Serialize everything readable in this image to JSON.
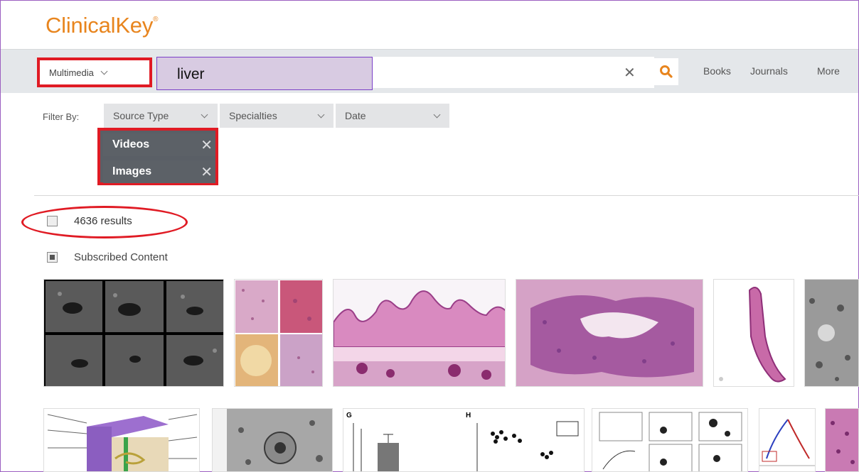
{
  "brand": {
    "name": "ClinicalKey",
    "mark": "®"
  },
  "search": {
    "scope_label": "Multimedia",
    "query": "liver"
  },
  "nav": [
    "Books",
    "Journals",
    "More"
  ],
  "filters": {
    "label": "Filter By:",
    "dropdowns": [
      "Source Type",
      "Specialties",
      "Date"
    ],
    "active_chips": [
      "Videos",
      "Images"
    ]
  },
  "results": {
    "count_text": "4636 results",
    "subscribed_label": "Subscribed Content"
  },
  "thumbnails_row1": [
    "ultrasound-grid",
    "histology-quad",
    "histology-wide",
    "histology-glands",
    "histology-villus",
    "electron-micrograph"
  ],
  "thumbnails_row2": [
    "anatomy-diagram",
    "electron-micrograph-cell",
    "bar-chart-figure",
    "scatter-chart-figure",
    "flow-cytometry-figure",
    "vascular-diagram",
    "histology-partial"
  ],
  "colors": {
    "brand_orange": "#e8851e",
    "highlight_red": "#e01b24",
    "query_highlight": "#d8cbe2",
    "chip_bg": "#5c6167",
    "search_icon": "#e8851e"
  }
}
